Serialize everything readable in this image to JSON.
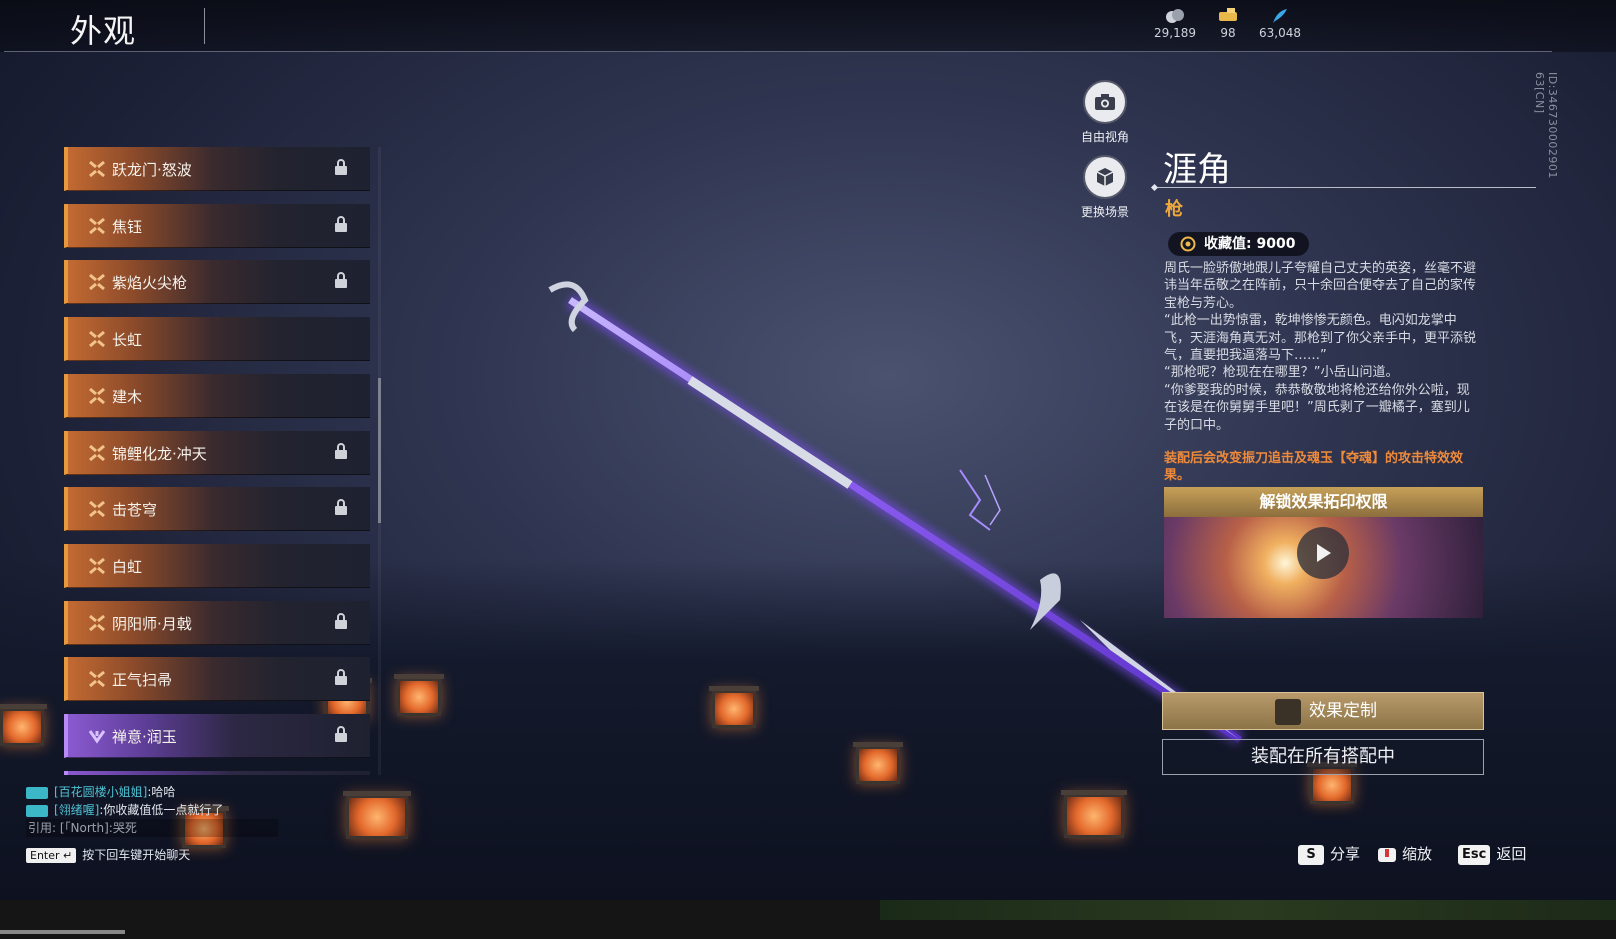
{
  "header": {
    "title": "外观",
    "currencies": [
      {
        "icon": "coin-icon",
        "value": "29,189"
      },
      {
        "icon": "ticket-icon",
        "value": "98"
      },
      {
        "icon": "feather-icon",
        "value": "63,048"
      }
    ]
  },
  "player_id": "ID:346730002901 63[CN]",
  "skin_list": [
    {
      "label": "跃龙门·怒波",
      "locked": true,
      "rarity": "orange"
    },
    {
      "label": "焦钰",
      "locked": true,
      "rarity": "orange"
    },
    {
      "label": "紫焰火尖枪",
      "locked": true,
      "rarity": "orange"
    },
    {
      "label": "长虹",
      "locked": false,
      "rarity": "orange"
    },
    {
      "label": "建木",
      "locked": false,
      "rarity": "orange"
    },
    {
      "label": "锦鲤化龙·冲天",
      "locked": true,
      "rarity": "orange"
    },
    {
      "label": "击苍穹",
      "locked": true,
      "rarity": "orange"
    },
    {
      "label": "白虹",
      "locked": false,
      "rarity": "orange"
    },
    {
      "label": "阴阳师·月戟",
      "locked": true,
      "rarity": "orange"
    },
    {
      "label": "正气扫帚",
      "locked": true,
      "rarity": "orange"
    },
    {
      "label": "禅意·润玉",
      "locked": true,
      "rarity": "purple"
    }
  ],
  "view_buttons": {
    "free_view": "自由视角",
    "change_scene": "更换场景"
  },
  "weapon": {
    "name": "涯角",
    "type": "枪",
    "collection_label": "收藏值:",
    "collection_value": "9000",
    "description": [
      "周氏一脸骄傲地跟儿子夸耀自己丈夫的英姿，丝毫不避讳当年岳敬之在阵前，只十余回合便夺去了自己的家传宝枪与芳心。",
      "“此枪一出势惊雷，乾坤惨惨无颜色。电闪如龙掌中飞，天涯海角真无对。那枪到了你父亲手中，更平添锐气，直要把我逼落马下……”",
      "“那枪呢？枪现在在哪里？”小岳山问道。",
      "“你爹娶我的时候，恭恭敬敬地将枪还给你外公啦，现在该是在你舅舅手里吧！”周氏剥了一瓣橘子，塞到儿子的口中。"
    ],
    "effect_note": "装配后会改变振刀追击及魂玉【夺魂】的攻击特效效果。",
    "video_header": "解锁效果拓印权限",
    "customize_button": "效果定制",
    "equip_all_button": "装配在所有搭配中"
  },
  "chat": {
    "messages": [
      {
        "name": "[百花圆楼小姐姐]",
        "text": ":哈哈"
      },
      {
        "name": "[翎绪喔]",
        "text": ":你收藏值低一点就行了"
      }
    ],
    "quote": "引用: [「North]:哭死",
    "enter_key": "Enter ↵",
    "enter_hint": "按下回车键开始聊天"
  },
  "hints": [
    {
      "key": "S",
      "label": "分享"
    },
    {
      "key": "",
      "label": "缩放"
    },
    {
      "key": "Esc",
      "label": "返回"
    }
  ],
  "colors": {
    "accent_orange": "#e79a3c",
    "weapon_type": "#f0a83c",
    "effect_note": "#ee8a3a",
    "chat_name": "#4ec3d4"
  }
}
